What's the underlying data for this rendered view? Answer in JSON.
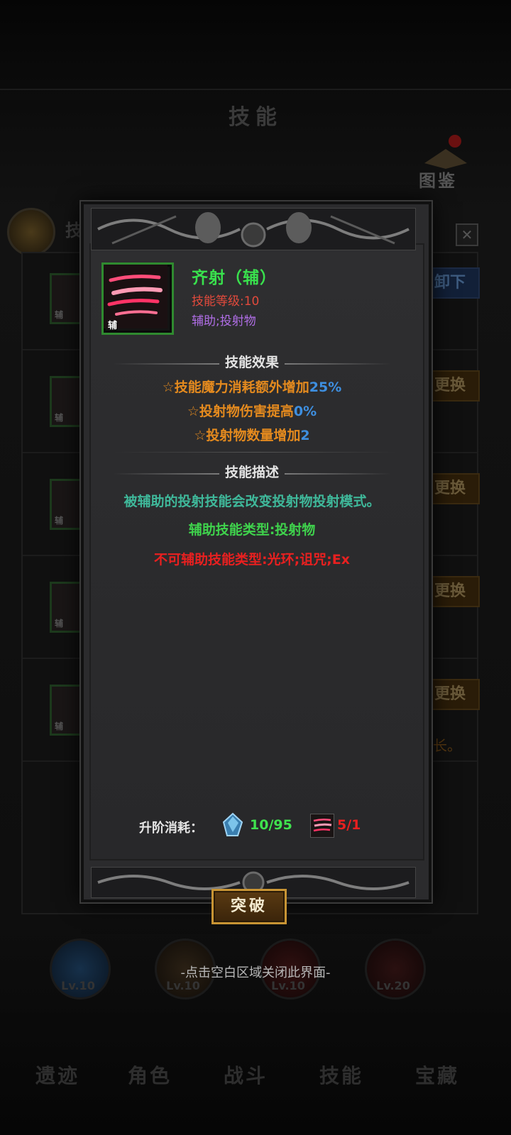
{
  "background": {
    "title": "技能",
    "atlas_label": "图鉴",
    "tab_label": "技",
    "close_symbol": "✕",
    "slot_tag": "辅",
    "unload_button": "卸下",
    "swap_button": "更换",
    "grow_text": "延长。",
    "skill_levels": [
      "Lv.10",
      "Lv.10",
      "Lv.10",
      "Lv.20"
    ],
    "nav": [
      "遗迹",
      "角色",
      "战斗",
      "技能",
      "宝藏"
    ],
    "close_hint": "-点击空白区域关闭此界面-"
  },
  "popup": {
    "icon_tag": "辅",
    "skill_name": "齐射（辅）",
    "skill_level": "技能等级:10",
    "skill_tags": "辅助;投射物",
    "effects_title": "技能效果",
    "effects": [
      {
        "text": "☆技能魔力消耗额外增加",
        "value": "25%"
      },
      {
        "text": "☆投射物伤害提高",
        "value": "0%"
      },
      {
        "text": "☆投射物数量增加",
        "value": "2"
      }
    ],
    "desc_title": "技能描述",
    "description": "被辅助的投射技能会改变投射物投射模式。",
    "support_types": "辅助技能类型:投射物",
    "unsupported_types": "不可辅助技能类型:光环;诅咒;Ex",
    "cost_label": "升阶消耗：",
    "cost_crystal": "10/95",
    "cost_skill": "5/1",
    "break_button": "突破"
  },
  "colors": {
    "name_green": "#39e14d",
    "level_red": "#e24a3c",
    "tag_purple": "#b06ee6",
    "effect_orange": "#e48a1e",
    "value_blue": "#3e8fe0",
    "desc_teal": "#3fb89a",
    "warn_red": "#e82020",
    "button_gold": "#c89434"
  },
  "icons": [
    "volley-skill-icon",
    "crystal-icon",
    "close-icon",
    "atlas-book-icon"
  ]
}
